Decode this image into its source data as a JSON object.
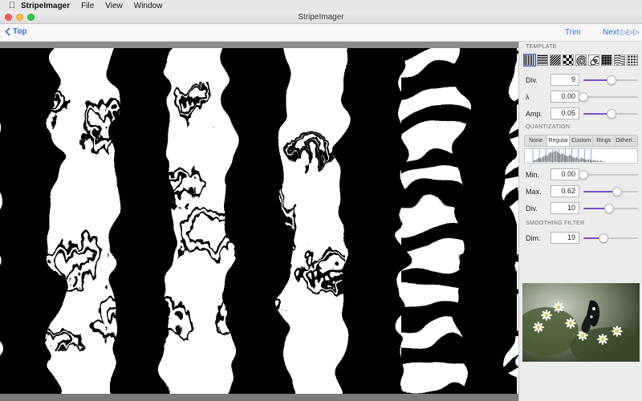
{
  "menubar": {
    "app_name": "StripeImager",
    "items": [
      "File",
      "View",
      "Window"
    ]
  },
  "window": {
    "title": "StripeImager"
  },
  "navbar": {
    "back_label": "Top",
    "trim_label": "Trim",
    "next_label": "Next",
    "next_glyphs": "▷▷▷"
  },
  "panel": {
    "template_title": "TEMPLATE",
    "template_selected_index": 0,
    "template_count": 9,
    "template_rows": [
      {
        "label": "Div.",
        "value": "9",
        "level": 0.52
      },
      {
        "label": "λ",
        "value": "0.00",
        "level": 0.0
      },
      {
        "label": "Amp.",
        "value": "0.05",
        "level": 0.52
      }
    ],
    "quantization_title": "QUANTIZATION",
    "quantization_modes": [
      "None",
      "Regular",
      "Custom",
      "Rings",
      "Ditheri..."
    ],
    "quantization_active": 1,
    "quantization_rows": [
      {
        "label": "Min.",
        "value": "0.00",
        "level": 0.0
      },
      {
        "label": "Max.",
        "value": "0.62",
        "level": 0.62
      },
      {
        "label": "Div.",
        "value": "10",
        "level": 0.47
      }
    ],
    "smoothing_title": "SMOOTHING FILTER",
    "smoothing_rows": [
      {
        "label": "Dim.",
        "value": "19",
        "level": 0.37
      }
    ]
  },
  "colors": {
    "accent": "#2f6ed8",
    "slider_fill": "#7b4fcf"
  }
}
